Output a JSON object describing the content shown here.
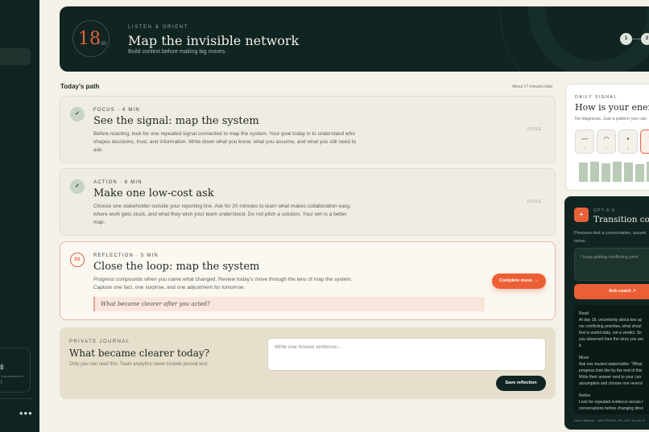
{
  "sidebar": {
    "more_label": "•••",
    "card_mark": "ǂ",
    "card_mini": "t"
  },
  "header": {
    "day_number": "18",
    "day_total": "/ 90",
    "eyebrow": "LISTEN & ORIENT",
    "title": "Map the invisible network",
    "subtitle": "Build context before making big moves.",
    "steps": [
      "1",
      "2"
    ]
  },
  "path": {
    "title": "Today's path",
    "meta": "About 17 minutes total",
    "tasks": [
      {
        "eyebrow": "FOCUS · 4 MIN",
        "title": "See the signal: map the system",
        "body": "Before reacting, look for one repeated signal connected to map the system. Your goal today is to understand who shapes decisions, trust, and information. Write down what you know, what you assume, and what you still need to ask.",
        "status": "DONE",
        "marker": "✓"
      },
      {
        "eyebrow": "ACTION · 8 MIN",
        "title": "Make one low-cost ask",
        "body": "Choose one stakeholder outside your reporting line. Ask for 20 minutes to learn what makes collaboration easy, where work gets stuck, and what they wish your team understood. Do not pitch a solution. Your win is a better map.",
        "status": "DONE",
        "marker": "✓"
      },
      {
        "eyebrow": "REFLECTION · 5 MIN",
        "title": "Close the loop: map the system",
        "body": "Progress compounds when you name what changed. Review today's move through the lens of map the system. Capture one fact, one surprise, and one adjustment for tomorrow.",
        "prompt": "What became clearer after you acted?",
        "button": "Complete move",
        "button_arrow": "→",
        "marker": "03"
      }
    ]
  },
  "journal": {
    "eyebrow": "PRIVATE JOURNAL",
    "title": "What became clearer today?",
    "subtitle": "Only you can read this. Team analytics never include journal text.",
    "placeholder": "Write one honest sentence...",
    "button": "Save reflection"
  },
  "signal": {
    "eyebrow": "DAILY SIGNAL",
    "title": "How is your energy?",
    "subtitle": "No diagnosis. Just a pattern you can",
    "options": [
      {
        "glyph": "—",
        "num": "1"
      },
      {
        "glyph": "◠",
        "num": "2"
      },
      {
        "glyph": "•",
        "num": "3"
      },
      {
        "glyph": "◝",
        "num": "4"
      }
    ],
    "history": [
      0.6,
      0.62,
      0.58,
      0.62,
      0.6,
      0.55,
      0.62,
      0.75,
      0.62
    ]
  },
  "coach": {
    "icon": "+",
    "eyebrow": "GPT-5.0",
    "title": "Transition coach",
    "subtitle_line1": "Pressure-test a conversation, assum",
    "subtitle_line2": "move.",
    "input_value": "I keep getting conflicting prior",
    "button": "Ask coach ↗",
    "output": {
      "read_heading": "Read",
      "read_lines": [
        "At day 18, uncertainty about two sp",
        "me conflicting priorities, what shoul",
        "first is useful data, not a verdict. Se",
        "you observed from the story you are",
        "it."
      ],
      "move_heading": "Move",
      "move_lines": [
        "Ask one trusted stakeholder: \"What",
        "progress look like by the end of this",
        "Write their answer next to your curr",
        "assumption and choose one reversi"
      ],
      "notice_heading": "Notice",
      "notice_lines": [
        "Look for repeated evidence across t",
        "conversations before changing direc"
      ]
    },
    "footer": "Demo fallback · add OPENAI_API_KEY for live G"
  }
}
